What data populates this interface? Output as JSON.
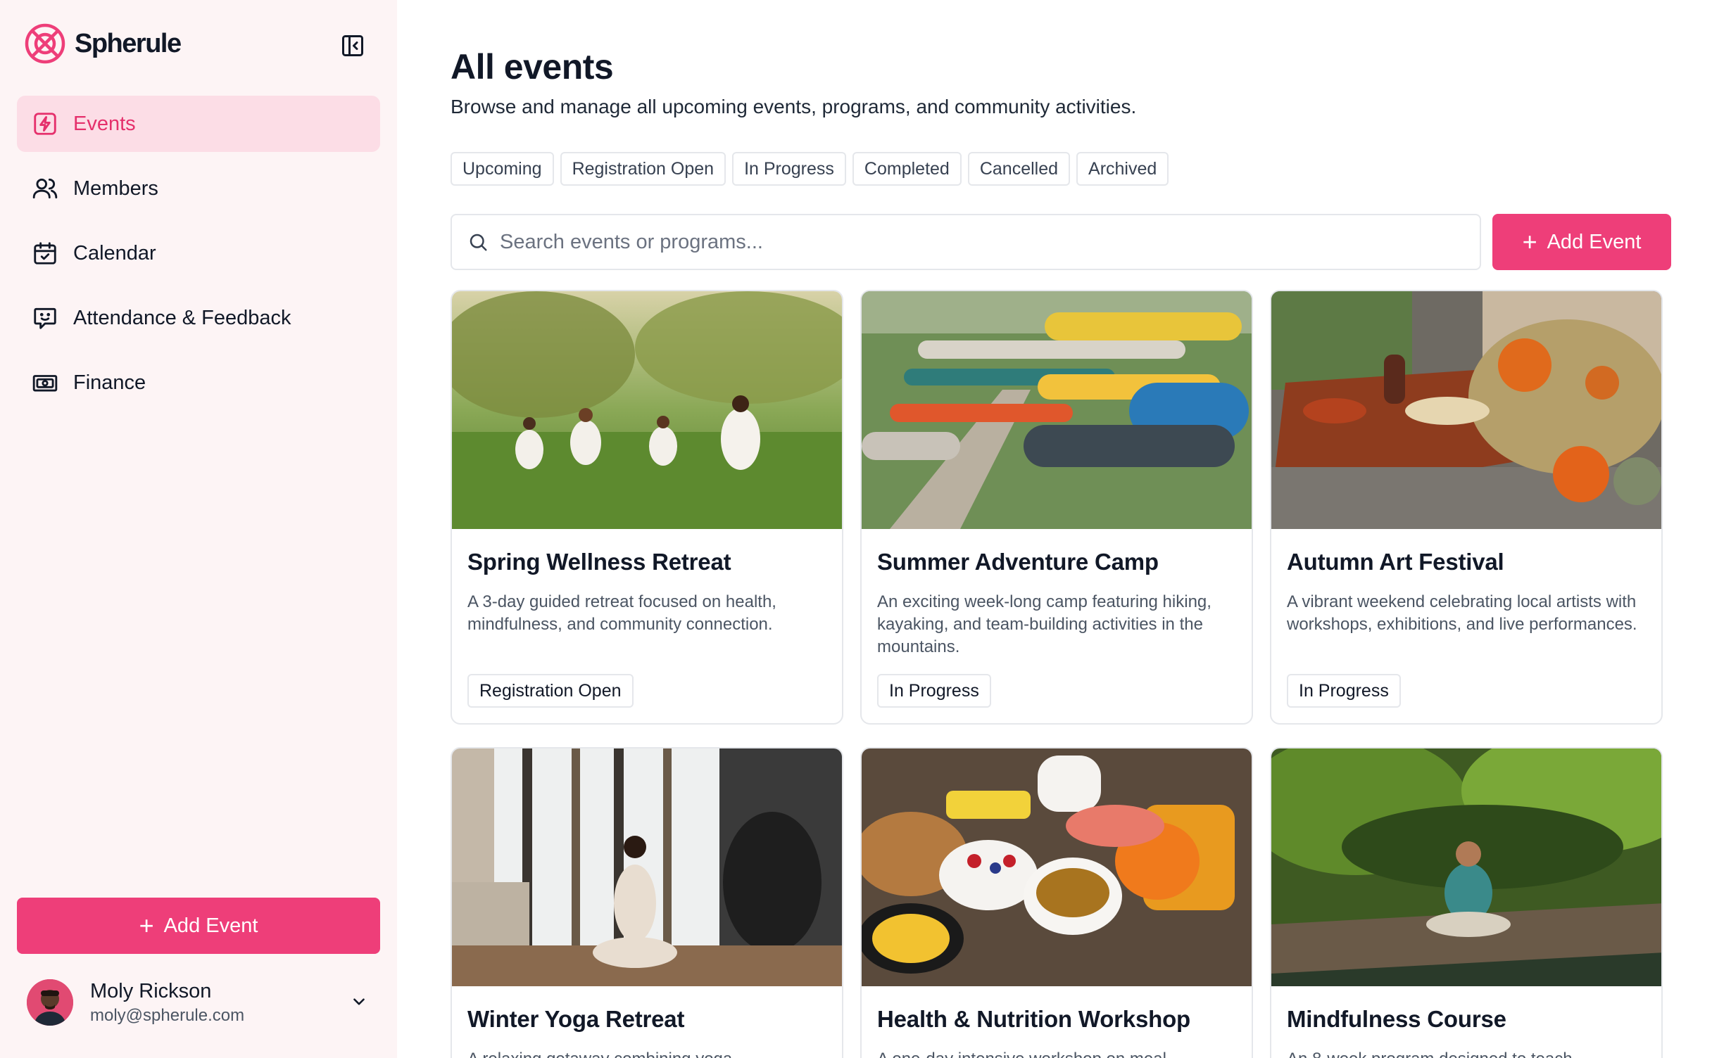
{
  "brand": {
    "name": "Spherule",
    "accent": "#ee3e79"
  },
  "sidebar": {
    "items": [
      {
        "label": "Events",
        "icon": "lightning-icon",
        "active": true
      },
      {
        "label": "Members",
        "icon": "users-icon"
      },
      {
        "label": "Calendar",
        "icon": "calendar-check-icon"
      },
      {
        "label": "Attendance & Feedback",
        "icon": "chat-smile-icon"
      },
      {
        "label": "Finance",
        "icon": "money-icon"
      }
    ],
    "add_label": "Add Event",
    "user": {
      "name": "Moly Rickson",
      "email": "moly@spherule.com"
    }
  },
  "main": {
    "title": "All events",
    "subtitle": "Browse and manage all upcoming events, programs, and community activities.",
    "filters": [
      "Upcoming",
      "Registration Open",
      "In Progress",
      "Completed",
      "Cancelled",
      "Archived"
    ],
    "search_placeholder": "Search events or programs...",
    "add_label": "Add Event",
    "events": [
      {
        "title": "Spring Wellness Retreat",
        "description": "A 3-day guided retreat focused on health, mindfulness, and community connection.",
        "status": "Registration Open"
      },
      {
        "title": "Summer Adventure Camp",
        "description": "An exciting week-long camp featuring hiking, kayaking, and team-building activities in the mountains.",
        "status": "In Progress"
      },
      {
        "title": "Autumn Art Festival",
        "description": "A vibrant weekend celebrating local artists with workshops, exhibitions, and live performances.",
        "status": "In Progress"
      },
      {
        "title": "Winter Yoga Retreat",
        "description": "A relaxing getaway combining yoga"
      },
      {
        "title": "Health & Nutrition Workshop",
        "description": "A one-day intensive workshop on meal"
      },
      {
        "title": "Mindfulness Course",
        "description": "An 8-week program designed to teach"
      }
    ]
  }
}
